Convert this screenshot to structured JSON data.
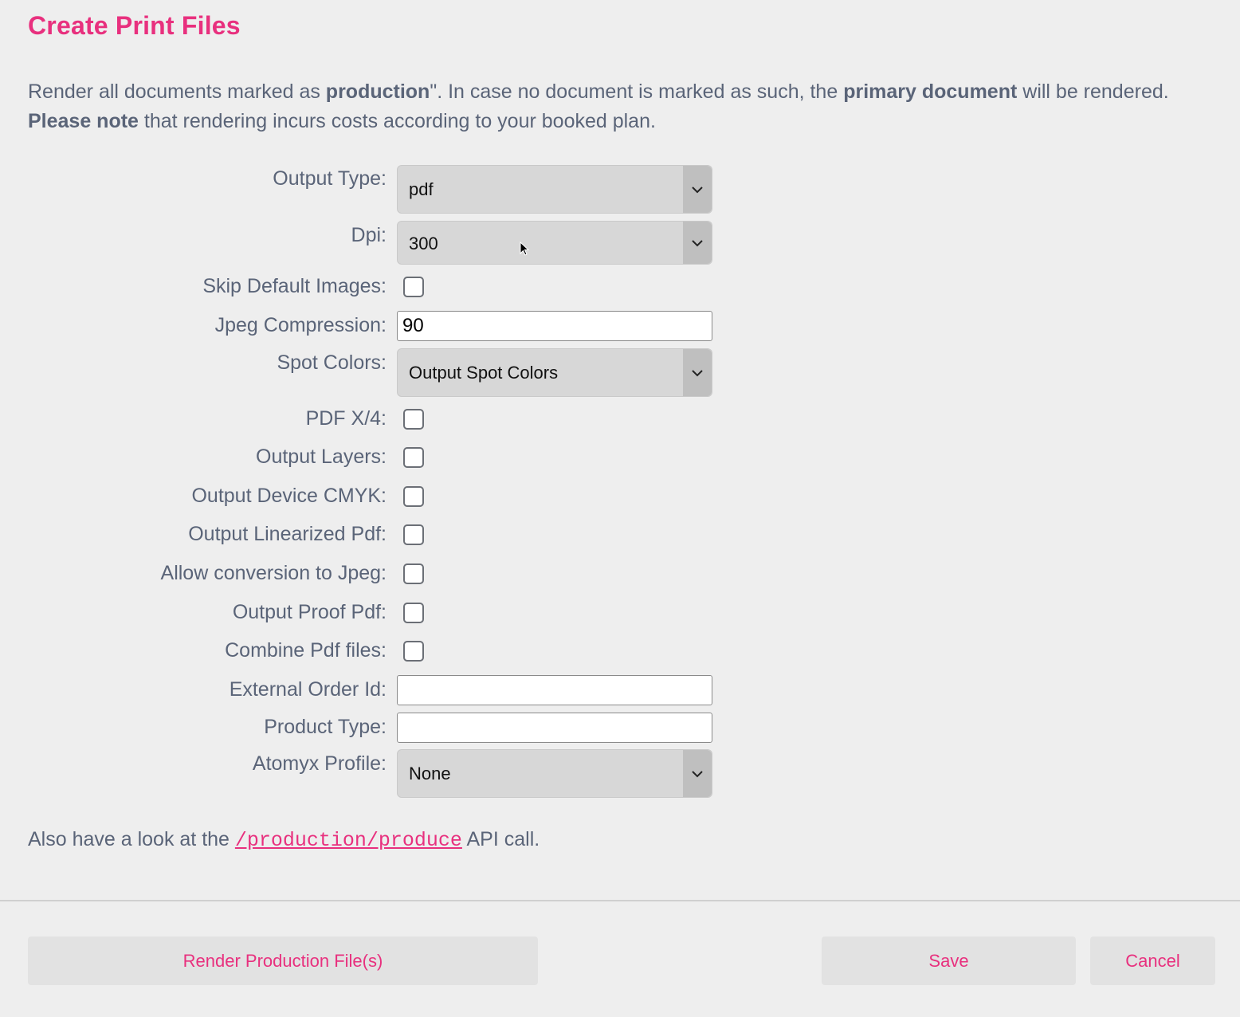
{
  "title": "Create Print Files",
  "intro": {
    "part1": "Render all documents marked as ",
    "bold1": "production",
    "part2": "\". In case no document is marked as such, the ",
    "bold2": "primary document",
    "part3": " will be rendered.",
    "bold3": "Please note",
    "part4": " that rendering incurs costs according to your booked plan."
  },
  "form": {
    "output_type": {
      "label": "Output Type:",
      "value": "pdf"
    },
    "dpi": {
      "label": "Dpi:",
      "value": "300"
    },
    "skip_default_images": {
      "label": "Skip Default Images:",
      "checked": false
    },
    "jpeg_compression": {
      "label": "Jpeg Compression:",
      "value": "90"
    },
    "spot_colors": {
      "label": "Spot Colors:",
      "value": "Output Spot Colors"
    },
    "pdf_x4": {
      "label": "PDF X/4:",
      "checked": false
    },
    "output_layers": {
      "label": "Output Layers:",
      "checked": false
    },
    "output_device_cmyk": {
      "label": "Output Device CMYK:",
      "checked": false
    },
    "output_linearized_pdf": {
      "label": "Output Linearized Pdf:",
      "checked": false
    },
    "allow_conversion_jpeg": {
      "label": "Allow conversion to Jpeg:",
      "checked": false
    },
    "output_proof_pdf": {
      "label": "Output Proof Pdf:",
      "checked": false
    },
    "combine_pdf_files": {
      "label": "Combine Pdf files:",
      "checked": false
    },
    "external_order_id": {
      "label": "External Order Id:",
      "value": ""
    },
    "product_type": {
      "label": "Product Type:",
      "value": ""
    },
    "atomyx_profile": {
      "label": "Atomyx Profile:",
      "value": "None"
    }
  },
  "footer_note": {
    "before": "Also have a look at the ",
    "link": "/production/produce",
    "after": " API call."
  },
  "buttons": {
    "render": "Render Production File(s)",
    "save": "Save",
    "cancel": "Cancel"
  },
  "colors": {
    "accent": "#e8307e",
    "text": "#5a6478",
    "background": "#eeeeee"
  }
}
